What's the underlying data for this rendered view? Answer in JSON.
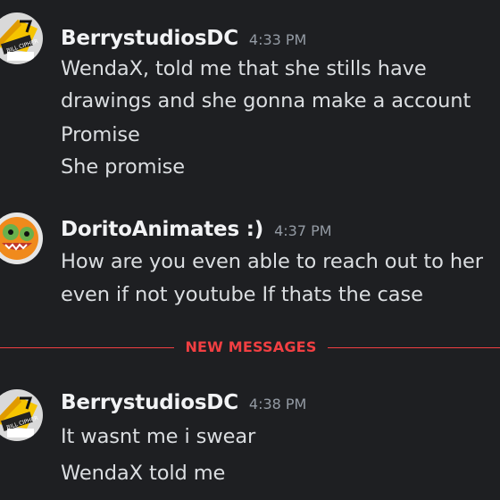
{
  "messages": [
    {
      "username": "BerrystudiosDC",
      "timestamp": "4:33 PM",
      "avatar_icon": "berry-avatar-icon",
      "lines": [
        "WendaX, told me that she stills have",
        "drawings and she gonna make a account",
        "Promise",
        "She promise"
      ]
    },
    {
      "username": "DoritoAnimates :)",
      "timestamp": "4:37 PM",
      "avatar_icon": "dorito-avatar-icon",
      "lines": [
        "How are you even able to reach out to her",
        "even if not youtube If thats the case"
      ]
    },
    {
      "username": "BerrystudiosDC",
      "timestamp": "4:38 PM",
      "avatar_icon": "berry-avatar-icon",
      "lines": [
        "It wasnt me i swear",
        "WendaX told me"
      ]
    }
  ],
  "divider": {
    "label": "NEW MESSAGES",
    "color": "#f23f42"
  },
  "colors": {
    "background": "#1e1f22",
    "username": "#f2f3f5",
    "timestamp": "#949ba4",
    "text": "#dbdee1"
  }
}
